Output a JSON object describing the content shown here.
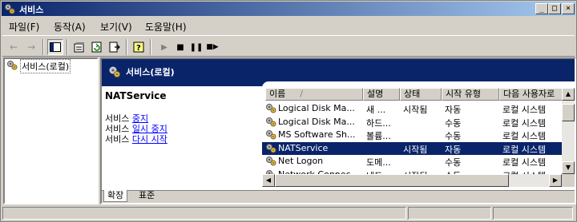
{
  "window": {
    "title": "서비스",
    "controls": {
      "minimize": "_",
      "maximize": "□",
      "close": "×"
    }
  },
  "menu": [
    {
      "label": "파일(F)"
    },
    {
      "label": "동작(A)"
    },
    {
      "label": "보기(V)"
    },
    {
      "label": "도움말(H)"
    }
  ],
  "toolbar": {
    "icons": [
      "back-arrow-icon",
      "forward-arrow-icon",
      "show-hide-tree-icon",
      "properties-icon",
      "refresh-icon",
      "export-list-icon",
      "help-icon",
      "start-service-icon",
      "stop-service-icon",
      "pause-service-icon",
      "restart-service-icon"
    ]
  },
  "tree": {
    "root_label": "서비스(로컬)"
  },
  "detail": {
    "header_title": "서비스(로컬)",
    "service_name": "NATService",
    "actions": [
      {
        "prefix": "서비스 ",
        "link": "중지"
      },
      {
        "prefix": "서비스 ",
        "link": "일시 중지"
      },
      {
        "prefix": "서비스 ",
        "link": "다시 시작"
      }
    ]
  },
  "list": {
    "columns": [
      "이름",
      "설명",
      "상태",
      "시작 유형",
      "다음 사용자로"
    ],
    "sort_indicator": "/",
    "rows": [
      {
        "name": "Logical Disk Ma...",
        "desc": "새 ...",
        "status": "시작됨",
        "startup": "자동",
        "logon": "로컬 시스템",
        "selected": false
      },
      {
        "name": "Logical Disk Ma...",
        "desc": "하드...",
        "status": "",
        "startup": "수동",
        "logon": "로컬 시스템",
        "selected": false
      },
      {
        "name": "MS Software Sh...",
        "desc": "볼륨...",
        "status": "",
        "startup": "수동",
        "logon": "로컬 시스템",
        "selected": false
      },
      {
        "name": "NATService",
        "desc": "",
        "status": "시작됨",
        "startup": "자동",
        "logon": "로컬 시스템",
        "selected": true
      },
      {
        "name": "Net Logon",
        "desc": "도메...",
        "status": "",
        "startup": "수동",
        "logon": "로컬 시스템",
        "selected": false
      },
      {
        "name": "Network Connec...",
        "desc": "네트...",
        "status": "시작됨",
        "startup": "수동",
        "logon": "로컬 시스템",
        "selected": false
      }
    ]
  },
  "tabs": [
    {
      "label": "확장",
      "active": true
    },
    {
      "label": "표준",
      "active": false
    }
  ],
  "colors": {
    "title_start": "#0a246a",
    "title_end": "#a6caf0",
    "selection": "#0a246a",
    "link": "#0000ff"
  }
}
